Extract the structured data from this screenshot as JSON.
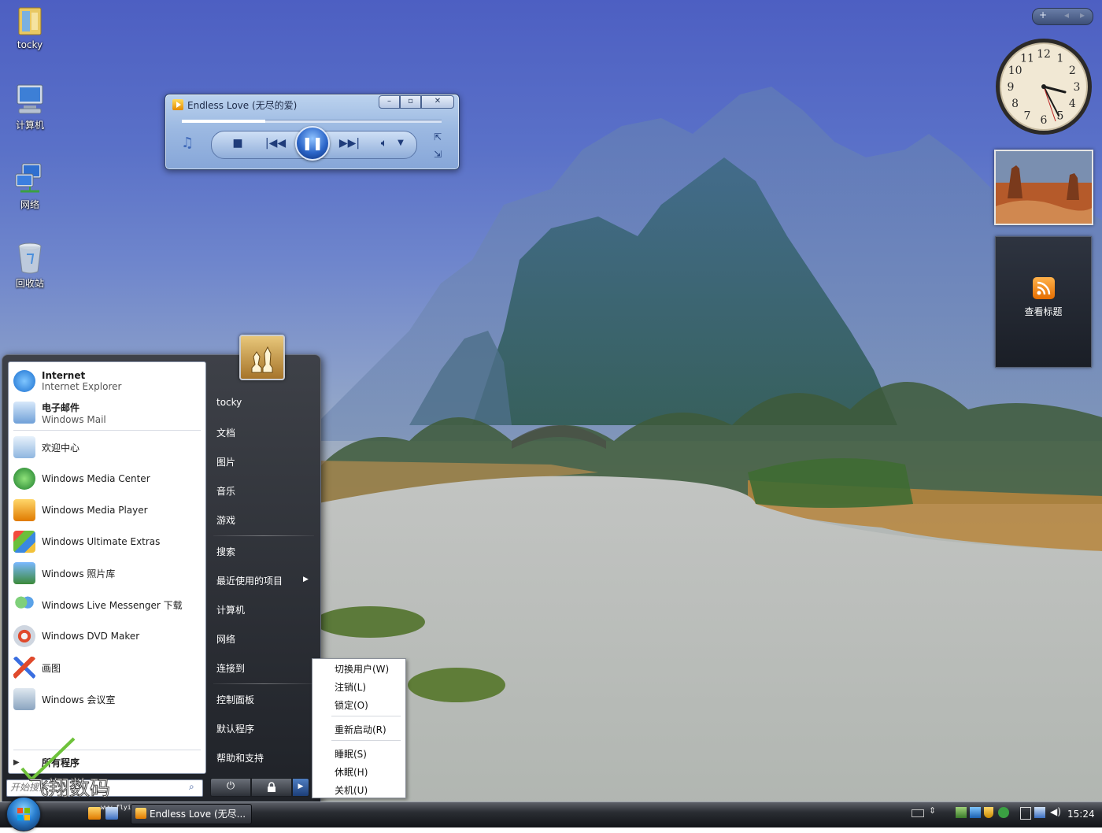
{
  "desktop": {
    "icons": [
      {
        "label": "tocky",
        "icon": "user-folder-icon"
      },
      {
        "label": "计算机",
        "icon": "computer-icon"
      },
      {
        "label": "网络",
        "icon": "network-icon"
      },
      {
        "label": "回收站",
        "icon": "recycle-bin-icon"
      }
    ]
  },
  "media_player": {
    "title": "Endless Love (无尽的爱)",
    "buttons": [
      "minimize",
      "maximize",
      "close"
    ],
    "progress": 0.32,
    "controls": [
      "stop-icon",
      "previous-icon",
      "pause-icon",
      "next-icon",
      "volume-icon",
      "switch-to-library-icon"
    ]
  },
  "gadgets": {
    "sidebar_controls": {
      "add": "+",
      "prev": "◂",
      "next": "▸"
    },
    "clock": {
      "time": "15:24",
      "numerals": [
        "12",
        "1",
        "2",
        "3",
        "4",
        "5",
        "6",
        "7",
        "8",
        "9",
        "10",
        "11"
      ]
    },
    "feed_label": "查看标题"
  },
  "start_menu": {
    "pinned": [
      {
        "title": "Internet",
        "subtitle": "Internet Explorer",
        "icon": "internet-explorer-icon"
      },
      {
        "title": "电子邮件",
        "subtitle": "Windows Mail",
        "icon": "windows-mail-icon"
      }
    ],
    "programs": [
      {
        "label": "欢迎中心",
        "icon": "welcome-center-icon"
      },
      {
        "label": "Windows Media Center",
        "icon": "media-center-icon"
      },
      {
        "label": "Windows Media Player",
        "icon": "media-player-icon"
      },
      {
        "label": "Windows Ultimate Extras",
        "icon": "ultimate-extras-icon"
      },
      {
        "label": "Windows 照片库",
        "icon": "photo-gallery-icon"
      },
      {
        "label": "Windows Live Messenger 下载",
        "icon": "messenger-icon"
      },
      {
        "label": "Windows DVD Maker",
        "icon": "dvd-maker-icon"
      },
      {
        "label": "画图",
        "icon": "paint-icon"
      },
      {
        "label": "Windows 会议室",
        "icon": "meeting-space-icon"
      }
    ],
    "all_programs": "所有程序",
    "search_placeholder": "开始搜索",
    "right": [
      {
        "label": "tocky"
      },
      {
        "label": "文档"
      },
      {
        "label": "图片"
      },
      {
        "label": "音乐"
      },
      {
        "label": "游戏"
      },
      {
        "label": "搜索"
      },
      {
        "label": "最近使用的项目"
      },
      {
        "label": "计算机"
      },
      {
        "label": "网络"
      },
      {
        "label": "连接到"
      },
      {
        "label": "控制面板"
      },
      {
        "label": "默认程序"
      },
      {
        "label": "帮助和支持"
      }
    ]
  },
  "power_menu": {
    "items": [
      "切换用户(W)",
      "注销(L)",
      "锁定(O)",
      "重新启动(R)",
      "睡眠(S)",
      "休眠(H)",
      "关机(U)"
    ]
  },
  "taskbar": {
    "task": "Endless Love (无尽...",
    "clock": "15:24",
    "watermark": "飞翔数码",
    "watermark_url": "www.flyitc.com"
  },
  "colors": {
    "accent": "#2c66c9",
    "taskbar": "#1b1e23",
    "start_menu_dark": "#2b2e35"
  }
}
